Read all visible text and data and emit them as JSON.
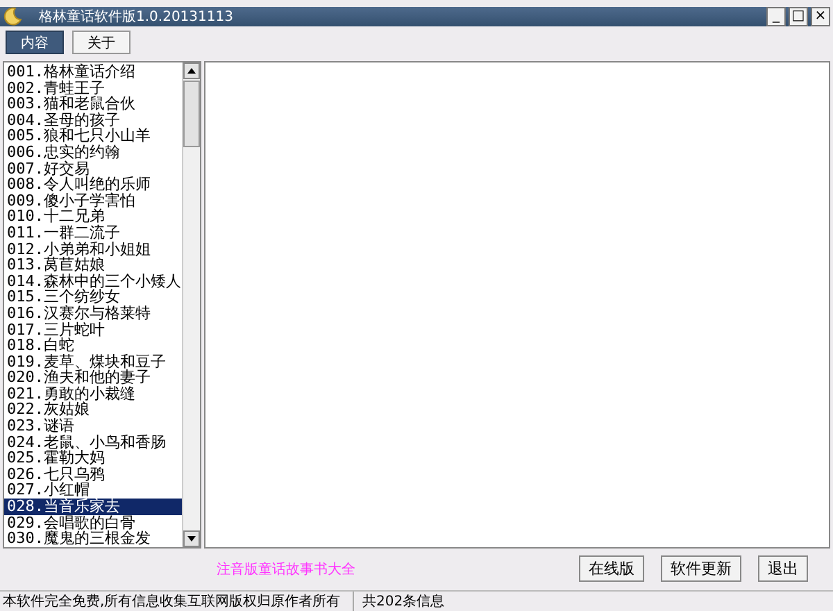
{
  "window": {
    "title": "格林童话软件版1.0.20131113",
    "controls": [
      "_",
      "□",
      "×"
    ]
  },
  "tabs": [
    {
      "label": "内容",
      "selected": true
    },
    {
      "label": "关于",
      "selected": false
    }
  ],
  "story_list": {
    "items": [
      {
        "label": "001.格林童话介绍",
        "selected": false
      },
      {
        "label": "002.青蛙王子",
        "selected": false
      },
      {
        "label": "003.猫和老鼠合伙",
        "selected": false
      },
      {
        "label": "004.圣母的孩子",
        "selected": false
      },
      {
        "label": "005.狼和七只小山羊",
        "selected": false
      },
      {
        "label": "006.忠实的约翰",
        "selected": false
      },
      {
        "label": "007.好交易",
        "selected": false
      },
      {
        "label": "008.令人叫绝的乐师",
        "selected": false
      },
      {
        "label": "009.傻小子学害怕",
        "selected": false
      },
      {
        "label": "010.十二兄弟",
        "selected": false
      },
      {
        "label": "011.一群二流子",
        "selected": false
      },
      {
        "label": "012.小弟弟和小姐姐",
        "selected": false
      },
      {
        "label": "013.莴苣姑娘",
        "selected": false
      },
      {
        "label": "014.森林中的三个小矮人",
        "selected": false
      },
      {
        "label": "015.三个纺纱女",
        "selected": false
      },
      {
        "label": "016.汉赛尔与格莱特",
        "selected": false
      },
      {
        "label": "017.三片蛇叶",
        "selected": false
      },
      {
        "label": "018.白蛇",
        "selected": false
      },
      {
        "label": "019.麦草、煤块和豆子",
        "selected": false
      },
      {
        "label": "020.渔夫和他的妻子",
        "selected": false
      },
      {
        "label": "021.勇敢的小裁缝",
        "selected": false
      },
      {
        "label": "022.灰姑娘",
        "selected": false
      },
      {
        "label": "023.谜语",
        "selected": false
      },
      {
        "label": "024.老鼠、小鸟和香肠",
        "selected": false
      },
      {
        "label": "025.霍勒大妈",
        "selected": false
      },
      {
        "label": "026.七只乌鸦",
        "selected": false
      },
      {
        "label": "027.小红帽",
        "selected": false
      },
      {
        "label": "028.当音乐家去",
        "selected": true
      },
      {
        "label": "029.会唱歌的白骨",
        "selected": false
      },
      {
        "label": "030.魔鬼的三根金发",
        "selected": false
      }
    ]
  },
  "promo_text": "注音版童话故事书大全",
  "buttons": [
    "在线版",
    "软件更新",
    "退出"
  ],
  "status_bar": [
    "本软件完全免费,所有信息收集互联网版权归原作者所有",
    "共202条信息"
  ]
}
